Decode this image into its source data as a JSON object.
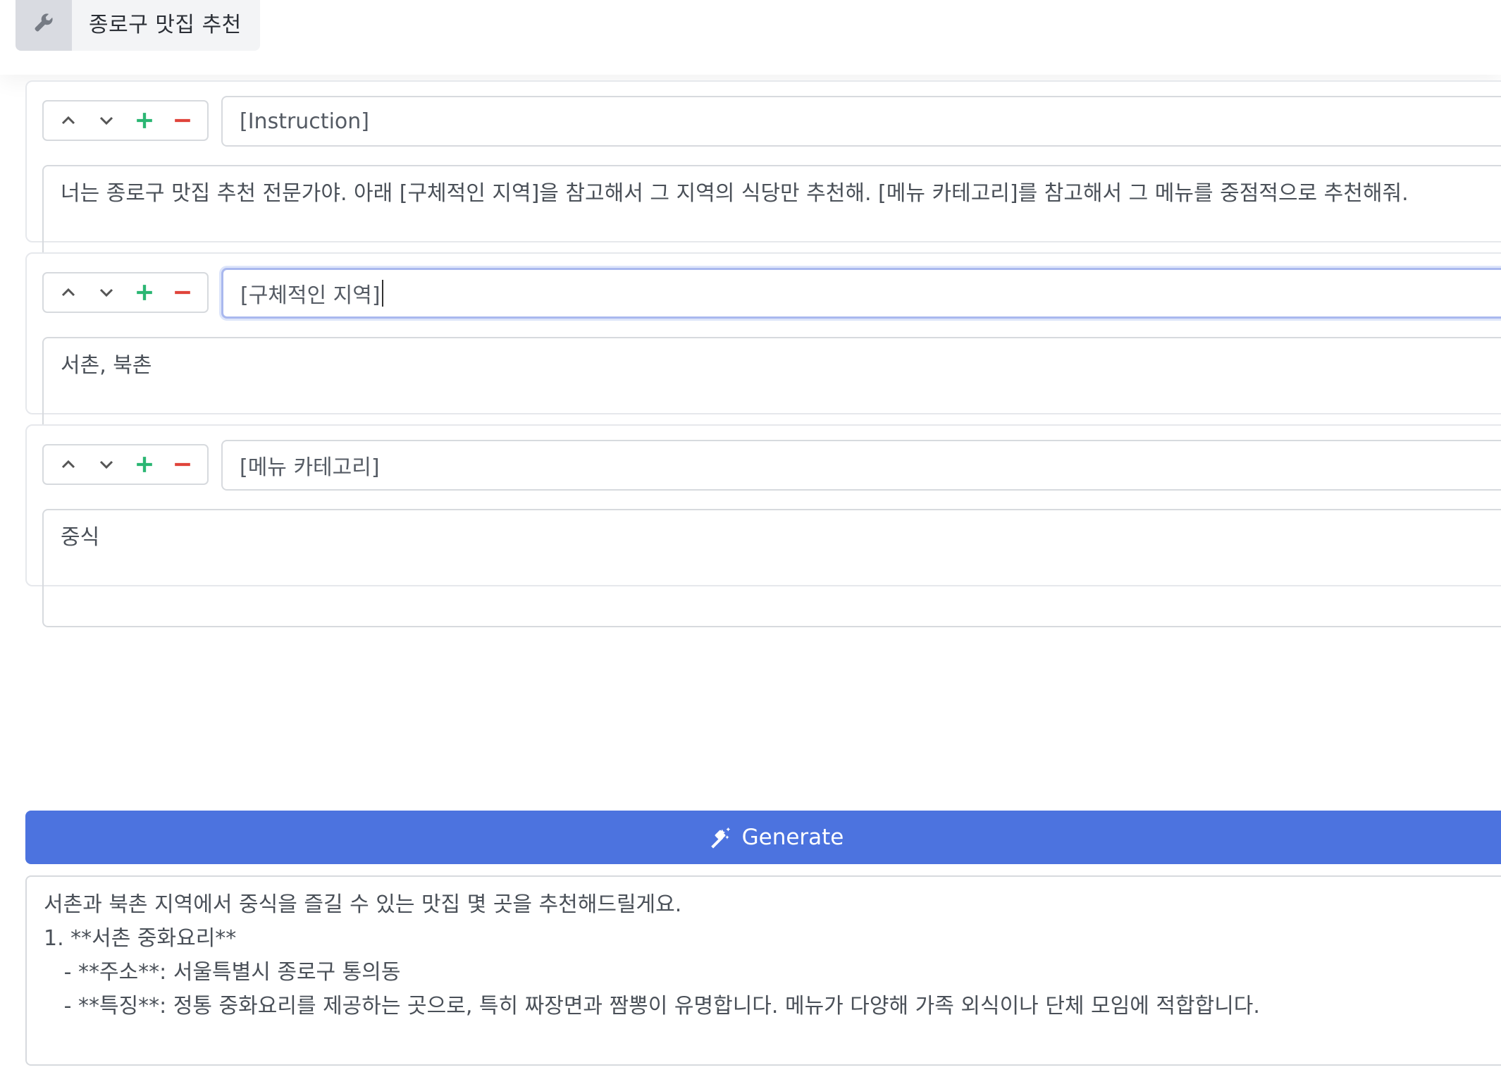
{
  "app": {
    "title": "종로구 맛집 추천",
    "icon": "wrench-icon"
  },
  "colors": {
    "accent": "#4c73df",
    "add": "#2bb673",
    "remove": "#e0443b"
  },
  "blocks": [
    {
      "key": "[Instruction]",
      "value": "너는 종로구 맛집 추천 전문가야. 아래 [구체적인 지역]을 참고해서 그 지역의 식당만 추천해.  [메뉴 카테고리]를 참고해서 그 메뉴를 중점적으로 추천해줘."
    },
    {
      "key": "[구체적인 지역]",
      "value": "서촌, 북촌"
    },
    {
      "key": "[메뉴 카테고리]",
      "value": "중식"
    }
  ],
  "generate_label": "Generate",
  "output": {
    "lines": [
      "서촌과 북촌 지역에서 중식을 즐길 수 있는 맛집 몇 곳을 추천해드릴게요.",
      "",
      "1. **서촌 중화요리**",
      "   - **주소**: 서울특별시 종로구 통의동",
      "   - **특징**: 정통 중화요리를 제공하는 곳으로, 특히 짜장면과 짬뽕이 유명합니다. 메뉴가 다양해 가족 외식이나 단체 모임에 적합합니다."
    ]
  }
}
